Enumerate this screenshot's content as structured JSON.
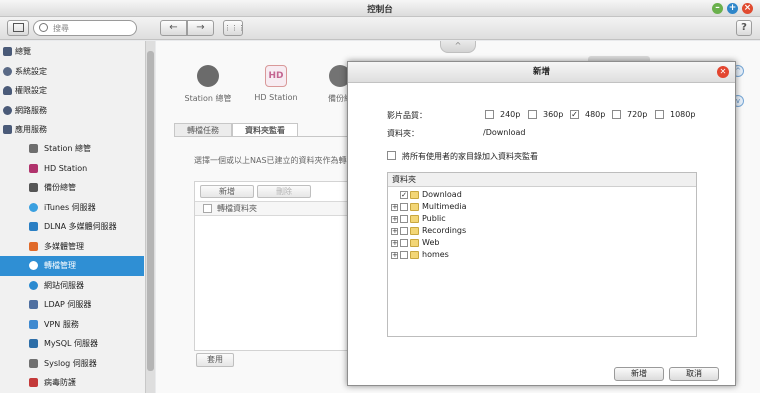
{
  "window": {
    "title": "控制台"
  },
  "search": {
    "placeholder": "搜尋"
  },
  "toolbar": {
    "back": "←",
    "forward": "→",
    "apps": "⋮⋮⋮",
    "help": "?"
  },
  "sidebar": {
    "items": [
      {
        "label": "總覽",
        "icon": "overview-icon",
        "color": "#4a5a78"
      },
      {
        "label": "系統設定",
        "icon": "gear-icon",
        "color": "#5a6a86"
      },
      {
        "label": "權限設定",
        "icon": "user-icon",
        "color": "#4a5a78"
      },
      {
        "label": "網路服務",
        "icon": "network-icon",
        "color": "#4a5a78"
      },
      {
        "label": "應用服務",
        "icon": "apps-icon",
        "color": "#4a5a78"
      }
    ],
    "subitems": [
      {
        "label": "Station 總管",
        "icon": "station-icon",
        "color": "#6e6e6e"
      },
      {
        "label": "HD Station",
        "icon": "hd-icon",
        "color": "#b0326c"
      },
      {
        "label": "備份總管",
        "icon": "backup-icon",
        "color": "#555555"
      },
      {
        "label": "iTunes 伺服器",
        "icon": "itunes-icon",
        "color": "#3aa0e0"
      },
      {
        "label": "DLNA 多媒體伺服器",
        "icon": "dlna-icon",
        "color": "#2a7fc4"
      },
      {
        "label": "多媒體管理",
        "icon": "multimedia-icon",
        "color": "#e06a2a"
      },
      {
        "label": "轉檔管理",
        "icon": "transcode-icon",
        "color": "#ffffff"
      },
      {
        "label": "網站伺服器",
        "icon": "web-icon",
        "color": "#2a8ad0"
      },
      {
        "label": "LDAP 伺服器",
        "icon": "ldap-icon",
        "color": "#4f6fa0"
      },
      {
        "label": "VPN 服務",
        "icon": "vpn-icon",
        "color": "#3f8ad0"
      },
      {
        "label": "MySQL 伺服器",
        "icon": "mysql-icon",
        "color": "#2d6ea8"
      },
      {
        "label": "Syslog 伺服器",
        "icon": "syslog-icon",
        "color": "#707070"
      },
      {
        "label": "病毒防護",
        "icon": "antivirus-icon",
        "color": "#c43a3a"
      }
    ],
    "active_index": 6
  },
  "apps": [
    {
      "label": "Station 總管",
      "icon": "station-icon",
      "color": "#3a3a3a"
    },
    {
      "label": "HD Station",
      "icon": "hd-icon",
      "color": "#b0326c",
      "glyph": "HD"
    },
    {
      "label": "備份總",
      "icon": "backup-icon",
      "color": "#444444"
    }
  ],
  "tabs": [
    {
      "label": "轉檔任務"
    },
    {
      "label": "資料夾監看"
    }
  ],
  "description": "選擇一個或以上NAS已建立的資料夾作為轉檔",
  "panel": {
    "add": "新增",
    "delete": "刪除",
    "column": "轉檔資料夾",
    "apply": "套用"
  },
  "dialog": {
    "title": "新增",
    "quality_label": "影片品質：",
    "qualities": [
      {
        "label": "240p",
        "checked": false
      },
      {
        "label": "360p",
        "checked": false
      },
      {
        "label": "480p",
        "checked": true
      },
      {
        "label": "720p",
        "checked": false
      },
      {
        "label": "1080p",
        "checked": false
      }
    ],
    "folder_label": "資料夾：",
    "folder_value": "/Download",
    "home_label": "將所有使用者的家目錄加入資料夾監看",
    "tree_header": "資料夾",
    "folders": [
      {
        "name": "Download",
        "checked": true,
        "expandable": false
      },
      {
        "name": "Multimedia",
        "checked": false,
        "expandable": true
      },
      {
        "name": "Public",
        "checked": false,
        "expandable": true
      },
      {
        "name": "Recordings",
        "checked": false,
        "expandable": true
      },
      {
        "name": "Web",
        "checked": false,
        "expandable": true
      },
      {
        "name": "homes",
        "checked": false,
        "expandable": true
      }
    ],
    "ok": "新增",
    "cancel": "取消"
  }
}
